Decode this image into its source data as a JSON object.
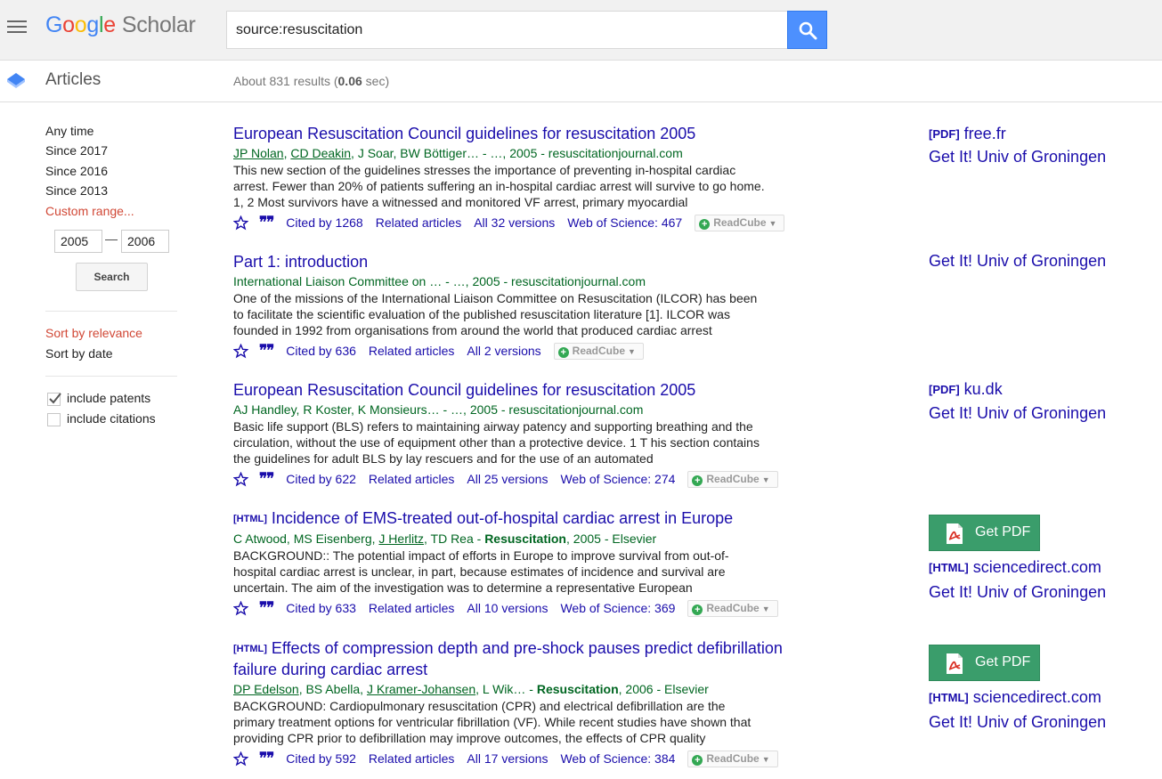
{
  "header": {
    "logo_google": [
      "G",
      "o",
      "o",
      "g",
      "l",
      "e"
    ],
    "logo_scholar": "Scholar",
    "search_value": "source:resuscitation"
  },
  "subheader": {
    "section_label": "Articles",
    "result_prefix": "About 831 results (",
    "result_time": "0.06",
    "result_suffix": " sec)"
  },
  "sidebar": {
    "time_filters": [
      "Any time",
      "Since 2017",
      "Since 2016",
      "Since 2013"
    ],
    "custom_range": "Custom range...",
    "year_from": "2005",
    "year_to": "2006",
    "range_dash": "—",
    "search_label": "Search",
    "sort_relevance": "Sort by relevance",
    "sort_date": "Sort by date",
    "include_patents": "include patents",
    "include_patents_checked": true,
    "include_citations": "include citations",
    "include_citations_checked": false
  },
  "results": [
    {
      "title": "European Resuscitation Council guidelines for resuscitation 2005",
      "meta": "JP Nolan, CD Deakin, J Soar, BW Böttiger… - …, 2005 - resuscitationjournal.com",
      "snippet": "This new section of the guidelines stresses the importance of preventing in-hospital cardiac arrest. Fewer than 20% of patients suffering an in-hospital cardiac arrest will survive to go home. 1, 2 Most survivors have a witnessed and monitored VF arrest, primary myocardial",
      "cited_by": "Cited by 1268",
      "related": "Related articles",
      "versions": "All 32 versions",
      "wos": "Web of Science: 467",
      "readcube": "ReadCube"
    },
    {
      "title": "Part 1: introduction",
      "meta": "International Liaison Committee on … - …, 2005 - resuscitationjournal.com",
      "snippet": "One of the missions of the International Liaison Committee on Resuscitation (ILCOR) has been to facilitate the scientific evaluation of the published resuscitation literature [1]. ILCOR was founded in 1992 from organisations from around the world that produced cardiac arrest",
      "cited_by": "Cited by 636",
      "related": "Related articles",
      "versions": "All 2 versions",
      "readcube": "ReadCube"
    },
    {
      "title": "European Resuscitation Council guidelines for resuscitation 2005",
      "meta": "AJ Handley, R Koster, K Monsieurs… - …, 2005 - resuscitationjournal.com",
      "snippet": "Basic life support (BLS) refers to maintaining airway patency and supporting breathing and the circulation, without the use of equipment other than a protective device. 1 T his section contains the guidelines for adult BLS by lay rescuers and for the use of an automated",
      "cited_by": "Cited by 622",
      "related": "Related articles",
      "versions": "All 25 versions",
      "wos": "Web of Science: 274",
      "readcube": "ReadCube"
    },
    {
      "tag": "[HTML]",
      "title": "Incidence of EMS-treated out-of-hospital cardiac arrest in Europe",
      "meta_a": "C Atwood, MS Eisenberg, ",
      "meta_link": "J Herlitz",
      "meta_b": ", TD Rea - ",
      "meta_bold": "Resuscitation",
      "meta_c": ", 2005 - Elsevier",
      "snippet": "BACKGROUND:: The potential impact of efforts in Europe to improve survival from out-of-hospital cardiac arrest is unclear, in part, because estimates of incidence and survival are uncertain. The aim of the investigation was to determine a representative European",
      "cited_by": "Cited by 633",
      "related": "Related articles",
      "versions": "All 10 versions",
      "wos": "Web of Science: 369",
      "readcube": "ReadCube"
    },
    {
      "tag": "[HTML]",
      "title": "Effects of compression depth and pre-shock pauses predict defibrillation failure during cardiac arrest",
      "meta_link1": "DP Edelson",
      "meta_a": ", BS Abella, ",
      "meta_link2": "J Kramer-Johansen",
      "meta_b": ", L Wik… - ",
      "meta_bold": "Resuscitation",
      "meta_c": ", 2006 - Elsevier",
      "snippet": "BACKGROUND: Cardiopulmonary resuscitation (CPR) and electrical defibrillation are the primary treatment options for ventricular fibrillation (VF). While recent studies have shown that providing CPR prior to defibrillation may improve outcomes, the effects of CPR quality",
      "cited_by": "Cited by 592",
      "related": "Related articles",
      "versions": "All 17 versions",
      "wos": "Web of Science: 384",
      "readcube": "ReadCube"
    }
  ],
  "right_links": {
    "r1_pdf_tag": "[PDF]",
    "r1_pdf": "free.fr",
    "getit": "Get It! Univ of Groningen",
    "r3_pdf_tag": "[PDF]",
    "r3_pdf": "ku.dk",
    "get_pdf": "Get PDF",
    "html_tag": "[HTML]",
    "sciencedirect": "sciencedirect.com"
  },
  "colors": {
    "link": "#1a0dab",
    "meta_green": "#006621",
    "accent_red": "#d14836",
    "search_blue": "#4d90fe",
    "getpdf_green": "#3a9d6b"
  },
  "icons": [
    "menu-icon",
    "search-icon",
    "articles-icon",
    "star-icon",
    "quote-icon",
    "plus-icon",
    "caret-icon",
    "checkmark-icon",
    "pdf-icon"
  ]
}
